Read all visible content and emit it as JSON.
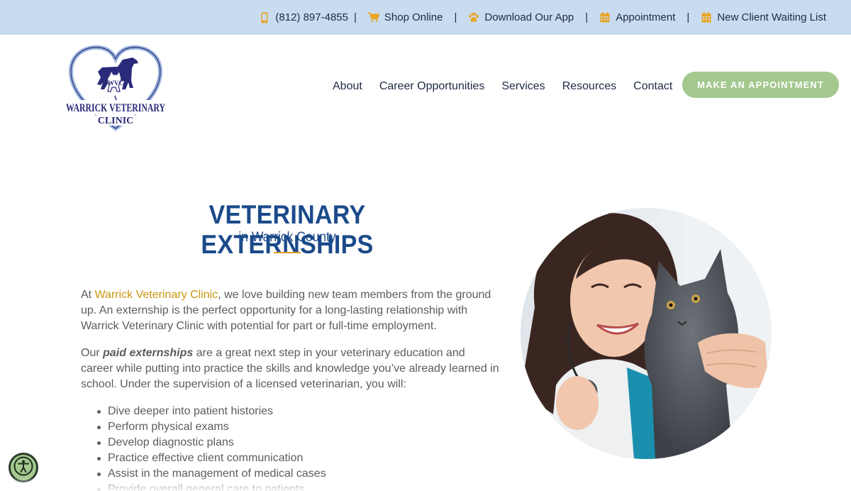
{
  "topbar": {
    "phone": "(812) 897-4855",
    "shop": "Shop Online",
    "app": "Download Our App",
    "appointment": "Appointment",
    "waiting": "New Client Waiting List",
    "separator": "|"
  },
  "logo": {
    "line1": "WARRICK VETERINARY",
    "line2": "CLINIC",
    "monogram": "WVC"
  },
  "nav": {
    "about": "About",
    "careers": "Career Opportunities",
    "services": "Services",
    "resources": "Resources",
    "contact": "Contact"
  },
  "cta_label": "MAKE AN APPOINTMENT",
  "heading": {
    "title": "VETERINARY EXTERNSHIPS",
    "subtitle": "in Warrick County"
  },
  "intro": {
    "prefix": "At ",
    "clinic_link": "Warrick Veterinary Clinic",
    "rest": ", we love building new team members from the ground up. An externship is the perfect opportunity for a long-lasting relationship with Warrick Veterinary Clinic with potential for part or full-time employment."
  },
  "para2": {
    "prefix": "Our ",
    "emphasis": "paid externships",
    "rest": " are a great next step in your veterinary education and career while putting into practice the skills and knowledge you’ve already learned in school. Under the supervision of a licensed veterinarian, you will:"
  },
  "duties": [
    "Dive deeper into patient histories",
    "Perform physical exams",
    "Develop diagnostic plans",
    "Practice effective client communication",
    "Assist in the management of medical cases",
    "Provide overall general care to patients"
  ],
  "colors": {
    "topbar_bg": "#c9dcef",
    "brand_blue": "#1b4a8a",
    "accent_gold": "#d89a26",
    "cta_green": "#a3c98f"
  },
  "icons": {
    "phone": "phone-icon",
    "shop": "cart-icon",
    "app": "paw-icon",
    "appointment": "calendar-icon",
    "waiting": "calendar-icon",
    "accessibility": "accessibility-icon"
  }
}
